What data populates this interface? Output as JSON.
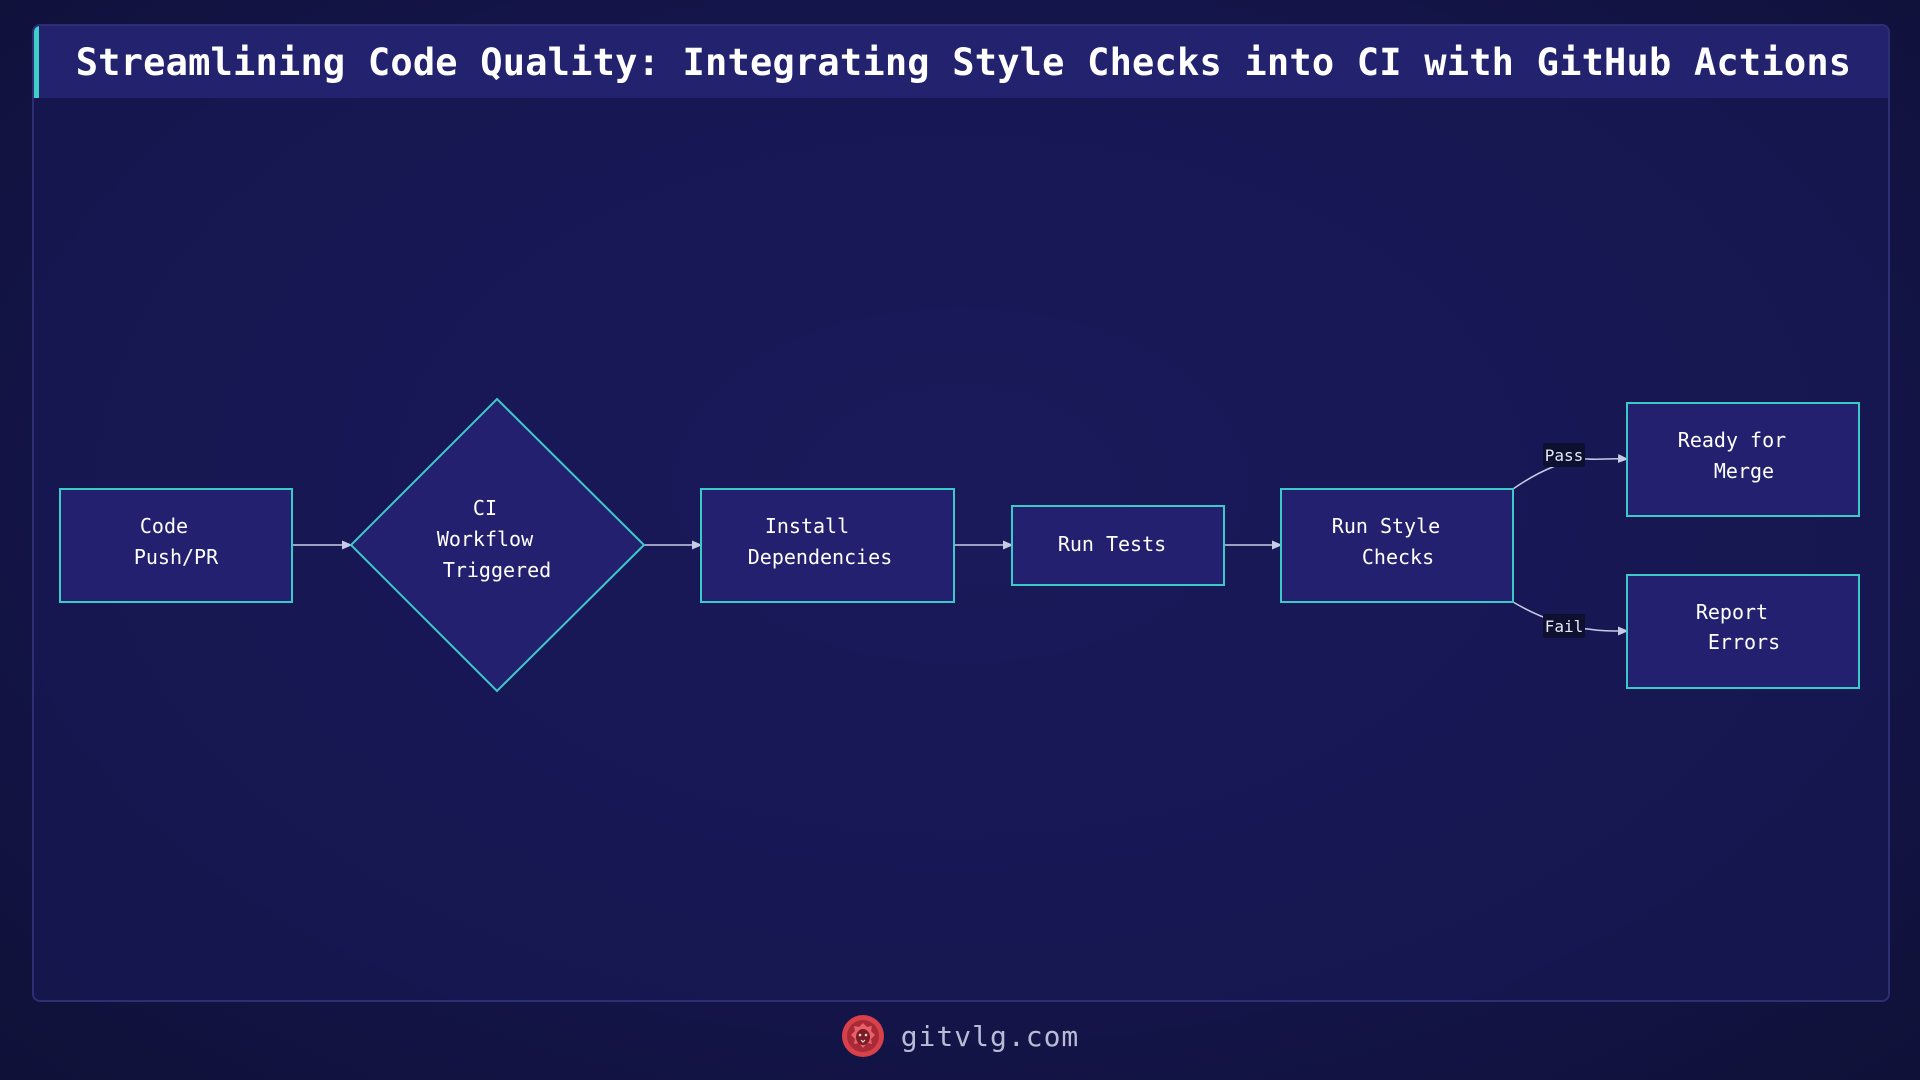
{
  "title": "Streamlining Code Quality: Integrating Style Checks into CI with GitHub Actions",
  "nodes": {
    "code_push": {
      "lines": [
        "Code",
        "Push/PR"
      ]
    },
    "ci_triggered": {
      "lines": [
        "CI",
        "Workflow",
        "Triggered"
      ]
    },
    "install_deps": {
      "lines": [
        "Install",
        "Dependencies"
      ]
    },
    "run_tests": {
      "lines": [
        "Run Tests"
      ]
    },
    "run_style": {
      "lines": [
        "Run Style",
        "Checks"
      ]
    },
    "ready_merge": {
      "lines": [
        "Ready for",
        "Merge"
      ]
    },
    "report_errors": {
      "lines": [
        "Report",
        "Errors"
      ]
    }
  },
  "edges": {
    "pass_label": "Pass",
    "fail_label": "Fail"
  },
  "footer": {
    "site": "gitvlg.com",
    "logo_icon": "lion-head-icon"
  },
  "colors": {
    "background": "#161650",
    "node_fill": "#23216f",
    "node_stroke": "#3ec9c9",
    "title_accent": "#3fd0c9",
    "logo": "#d8404a"
  }
}
